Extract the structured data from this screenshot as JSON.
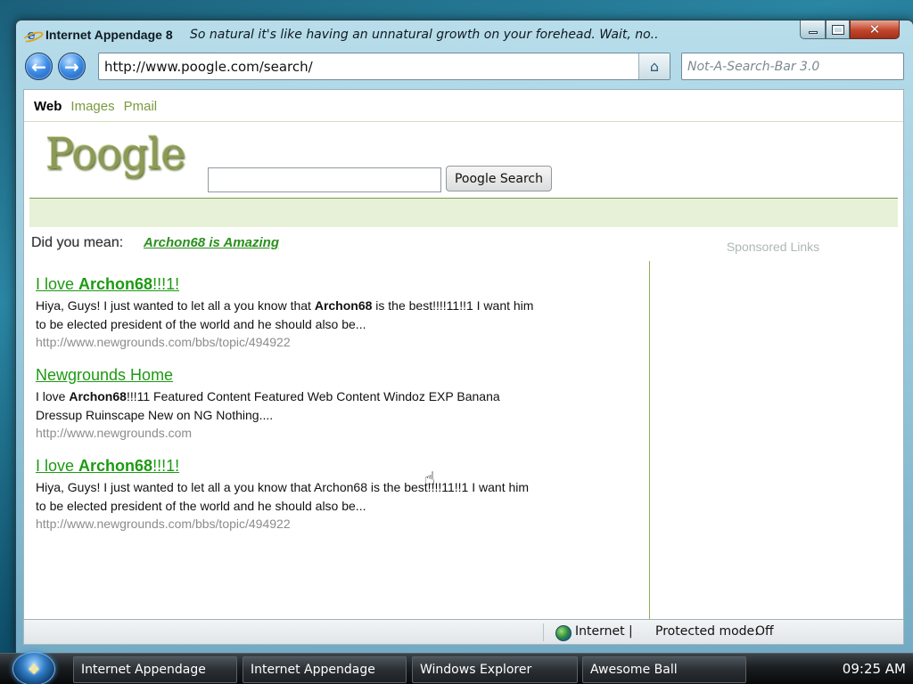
{
  "window": {
    "title": "Internet Appendage 8",
    "subtitle": "So natural it's like having an unnatural growth on your forehead. Wait, no..."
  },
  "nav": {
    "address": "http://www.poogle.com/search/",
    "search_placeholder": "Not-A-Search-Bar 3.0"
  },
  "page": {
    "tabs": [
      {
        "label": "Web",
        "active": true
      },
      {
        "label": "Images",
        "active": false
      },
      {
        "label": "Pmail",
        "active": false
      }
    ],
    "logo": "Poogle",
    "search_button": "Poogle Search",
    "did_you_mean_label": "Did you mean:",
    "suggestion": "Archon68 is Amazing",
    "sponsored": "Sponsored Links",
    "results": [
      {
        "title_pre": "I love ",
        "title_bold": "Archon68",
        "title_post": "!!!1!",
        "snippet_pre": "Hiya, Guys!   I just wanted to let all a you know that ",
        "snippet_bold": "Archon68",
        "snippet_post": " is the best!!!!11!!1 I want him to be elected president of the world and he should also be...",
        "url": "http://www.newgrounds.com/bbs/topic/494922"
      },
      {
        "title_pre": "Newgrounds Home",
        "title_bold": "",
        "title_post": "",
        "snippet_pre": "I love ",
        "snippet_bold": "Archon68",
        "snippet_post": "!!!11 Featured Content Featured Web Content Windoz EXP Banana Dressup Ruinscape New on NG Nothing....",
        "url": "http://www.newgrounds.com"
      },
      {
        "title_pre": "I love ",
        "title_bold": "Archon68",
        "title_post": "!!!1!",
        "snippet_pre": "Hiya, Guys!   I just wanted to let all a you know that Archon68 is the best!!!!11!!1 I want him to be elected president of the world and he should also be...",
        "snippet_bold": "",
        "snippet_post": "",
        "url": "http://www.newgrounds.com/bbs/topic/494922"
      }
    ]
  },
  "status": {
    "zone": "Internet",
    "separator": "|",
    "protected_mode_label": "Protected mode:",
    "protected_mode_value": "Off"
  },
  "taskbar": {
    "items": [
      "Internet Appendage",
      "Internet Appendage",
      "Windows Explorer",
      "Awesome Ball"
    ],
    "clock": "09:25 AM"
  },
  "icons": {
    "back": "back-arrow-icon",
    "forward": "forward-arrow-icon",
    "home": "home-icon",
    "globe": "globe-icon",
    "start": "windows-logo-icon"
  },
  "colors": {
    "link_green": "#1d9a12",
    "logo_olive": "#8b9a56",
    "band_green": "#e7f1d7"
  }
}
